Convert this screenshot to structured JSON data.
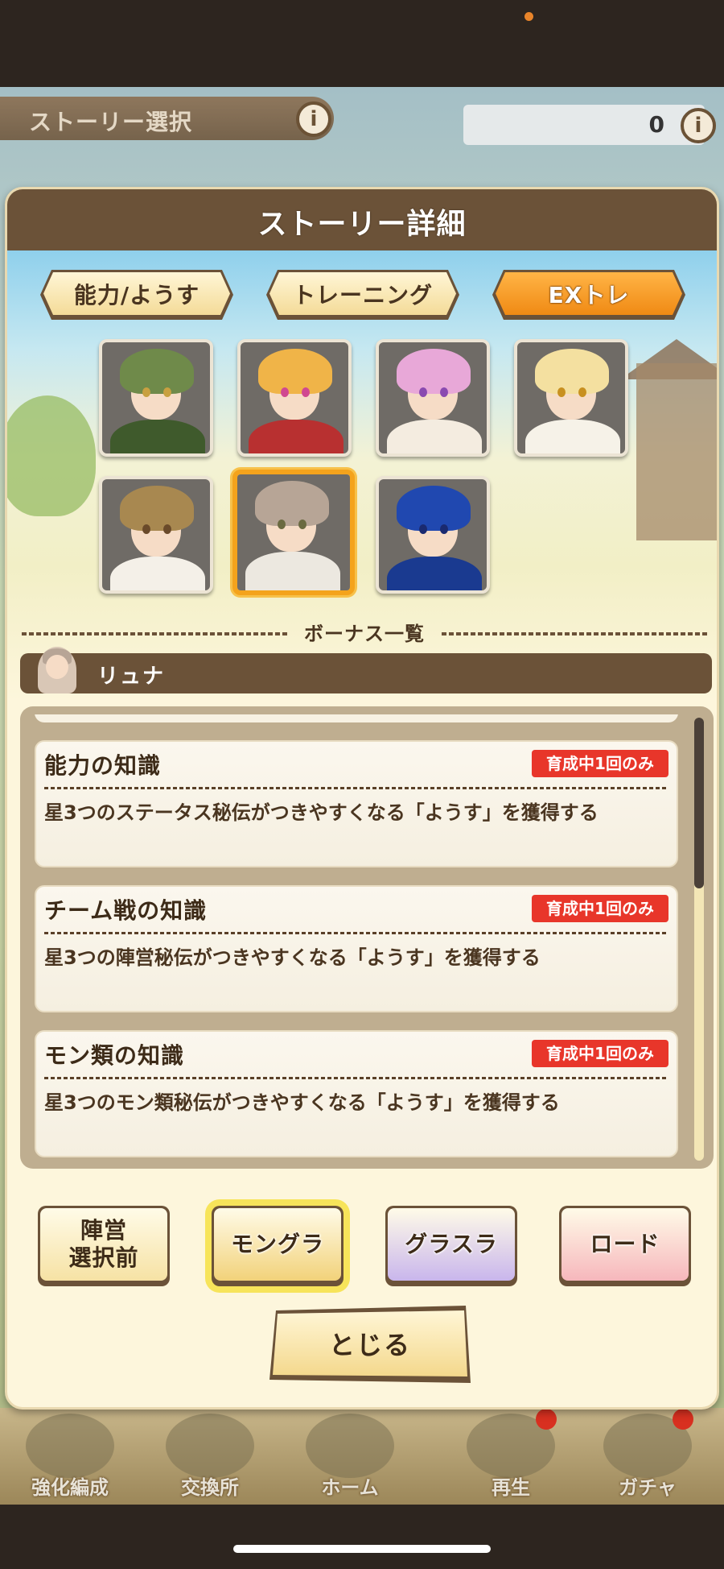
{
  "background": {
    "header_title": "ストーリー選択",
    "currency_value": "0",
    "nav": [
      {
        "label": "強化編成",
        "badge": false
      },
      {
        "label": "交換所",
        "badge": false
      },
      {
        "label": "ホーム",
        "badge": false
      },
      {
        "label": "再生",
        "badge": true
      },
      {
        "label": "ガチャ",
        "badge": true
      }
    ]
  },
  "modal": {
    "title": "ストーリー詳細",
    "tabs": [
      {
        "label": "能力/ようす",
        "active": false
      },
      {
        "label": "トレーニング",
        "active": false
      },
      {
        "label": "EXトレ",
        "active": true
      }
    ],
    "portraits": [
      {
        "id": "p1",
        "hair": "#6f8a4a",
        "body": "#3f5a2c",
        "eye": "#c8a040",
        "selected": false
      },
      {
        "id": "p2",
        "hair": "#f0b448",
        "body": "#b83030",
        "eye": "#d04890",
        "selected": false
      },
      {
        "id": "p3",
        "hair": "#e8a8d8",
        "body": "#f4ece0",
        "eye": "#8a4ab0",
        "selected": false
      },
      {
        "id": "p4",
        "hair": "#f4e0a0",
        "body": "#f6f2e8",
        "eye": "#c89020",
        "selected": false
      },
      {
        "id": "p5",
        "hair": "#a88850",
        "body": "#f4f0e8",
        "eye": "#6a4a2a",
        "selected": false
      },
      {
        "id": "p6",
        "hair": "#b7a596",
        "body": "#ece8e0",
        "eye": "#6a6a40",
        "selected": true
      },
      {
        "id": "p7",
        "hair": "#2048b0",
        "body": "#1a3a90",
        "eye": "#1a2a70",
        "selected": false
      }
    ],
    "bonus_list_title": "ボーナス一覧",
    "character_name": "リュナ",
    "bonuses": [
      {
        "title": "能力の知識",
        "badge": "育成中1回のみ",
        "description": "星3つのステータス秘伝がつきやすくなる「ようす」を獲得する"
      },
      {
        "title": "チーム戦の知識",
        "badge": "育成中1回のみ",
        "description": "星3つの陣営秘伝がつきやすくなる「ようす」を獲得する"
      },
      {
        "title": "モン類の知識",
        "badge": "育成中1回のみ",
        "description": "星3つのモン類秘伝がつきやすくなる「ようす」を獲得する"
      }
    ],
    "modes": [
      {
        "label_line1": "陣営",
        "label_line2": "選択前",
        "selected": false,
        "color": "#f6e2a4"
      },
      {
        "label_line1": "モングラ",
        "label_line2": "",
        "selected": true,
        "color": "#f2d27a"
      },
      {
        "label_line1": "グラスラ",
        "label_line2": "",
        "selected": false,
        "color": "#c9b6ec"
      },
      {
        "label_line1": "ロード",
        "label_line2": "",
        "selected": false,
        "color": "#f6b7bc"
      }
    ],
    "close_label": "とじる"
  }
}
